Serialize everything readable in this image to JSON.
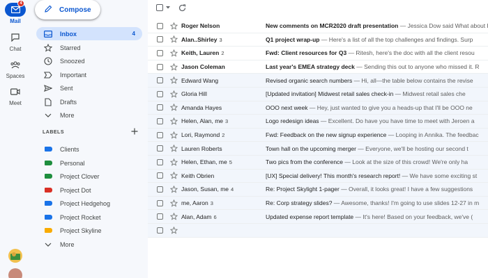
{
  "rail": {
    "mail": {
      "label": "Mail",
      "badge": "4"
    },
    "chat": {
      "label": "Chat"
    },
    "spaces": {
      "label": "Spaces"
    },
    "meet": {
      "label": "Meet"
    }
  },
  "compose": {
    "label": "Compose"
  },
  "nav": [
    {
      "label": "Inbox",
      "count": "4",
      "icon": "inbox-icon"
    },
    {
      "label": "Starred",
      "icon": "star-icon"
    },
    {
      "label": "Snoozed",
      "icon": "clock-icon"
    },
    {
      "label": "Important",
      "icon": "important-icon"
    },
    {
      "label": "Sent",
      "icon": "send-icon"
    },
    {
      "label": "Drafts",
      "icon": "draft-icon"
    },
    {
      "label": "More",
      "icon": "chevron-down-icon"
    }
  ],
  "labels": {
    "heading": "LABELS",
    "items": [
      {
        "label": "Clients",
        "color": "#1a73e8"
      },
      {
        "label": "Personal",
        "color": "#1e8e3e"
      },
      {
        "label": "Project Clover",
        "color": "#1e8e3e"
      },
      {
        "label": "Project Dot",
        "color": "#d93025"
      },
      {
        "label": "Project Hedgehog",
        "color": "#1a73e8"
      },
      {
        "label": "Project Rocket",
        "color": "#1a73e8"
      },
      {
        "label": "Project Skyline",
        "color": "#f9ab00"
      }
    ],
    "more": "More"
  },
  "emails": [
    {
      "sender": "Roger Nelson",
      "count": "",
      "subject": "New comments on MCR2020 draft presentation",
      "snippet": " — Jessica Dow said What about Eva",
      "unread": true
    },
    {
      "sender": "Alan..Shirley",
      "count": "3",
      "subject": "Q1 project wrap-up",
      "snippet": " — Here's a list of all the top challenges and findings. Surp",
      "unread": true
    },
    {
      "sender": "Keith, Lauren",
      "count": "2",
      "subject": "Fwd: Client resources for Q3",
      "snippet": " — Ritesh, here's the doc with all the client resou",
      "unread": true
    },
    {
      "sender": "Jason Coleman",
      "count": "",
      "subject": "Last year's EMEA strategy deck",
      "snippet": " — Sending this out to anyone who missed it. R",
      "unread": true
    },
    {
      "sender": "Edward Wang",
      "count": "",
      "subject": "Revised organic search numbers",
      "snippet": " — Hi, all—the table below contains the revise",
      "unread": false
    },
    {
      "sender": "Gloria Hill",
      "count": "",
      "subject": "[Updated invitation] Midwest retail sales check-in",
      "snippet": " — Midwest retail sales che",
      "unread": false
    },
    {
      "sender": "Amanda Hayes",
      "count": "",
      "subject": "OOO next week",
      "snippet": " — Hey, just wanted to give you a heads-up that I'll be OOO ne",
      "unread": false
    },
    {
      "sender": "Helen, Alan, me",
      "count": "3",
      "subject": "Logo redesign ideas",
      "snippet": " — Excellent. Do have you have time to meet with Jeroen a",
      "unread": false
    },
    {
      "sender": "Lori, Raymond",
      "count": "2",
      "subject": "Fwd: Feedback on the new signup experience",
      "snippet": " — Looping in Annika. The feedbac",
      "unread": false
    },
    {
      "sender": "Lauren Roberts",
      "count": "",
      "subject": "Town hall on the upcoming merger",
      "snippet": " — Everyone, we'll be hosting our second t",
      "unread": false
    },
    {
      "sender": "Helen, Ethan, me",
      "count": "5",
      "subject": "Two pics from the conference",
      "snippet": " — Look at the size of this crowd! We're only ha",
      "unread": false
    },
    {
      "sender": "Keith Obrien",
      "count": "",
      "subject": "[UX] Special delivery! This month's research report!",
      "snippet": " — We have some exciting st",
      "unread": false
    },
    {
      "sender": "Jason, Susan, me",
      "count": "4",
      "subject": "Re: Project Skylight 1-pager",
      "snippet": " — Overall, it looks great! I have a few suggestions",
      "unread": false
    },
    {
      "sender": "me, Aaron",
      "count": "3",
      "subject": "Re: Corp strategy slides?",
      "snippet": " — Awesome, thanks! I'm going to use slides 12-27 in m",
      "unread": false
    },
    {
      "sender": "Alan, Adam",
      "count": "6",
      "subject": "Updated expense report template",
      "snippet": " — It's here! Based on your feedback, we've (",
      "unread": false
    },
    {
      "sender": "",
      "count": "",
      "subject": "",
      "snippet": "",
      "unread": false
    }
  ]
}
